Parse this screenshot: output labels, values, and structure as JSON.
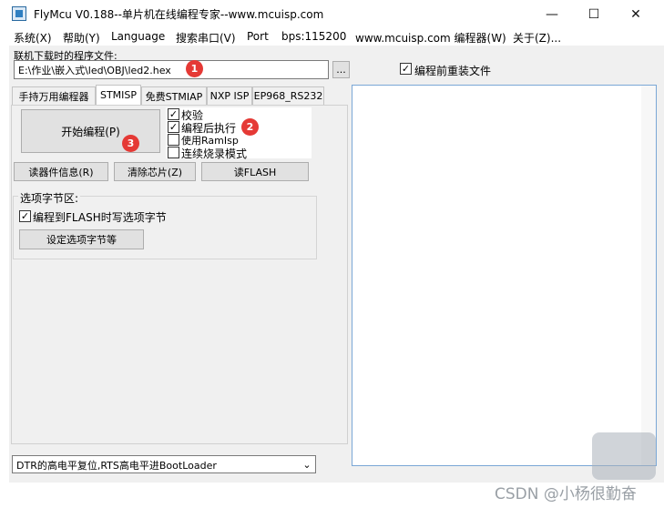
{
  "window": {
    "title": "FlyMcu V0.188--单片机在线编程专家--www.mcuisp.com",
    "minimize_symbol": "—",
    "maximize_symbol": "☐",
    "close_symbol": "✕"
  },
  "menu": [
    "系统(X)",
    "帮助(Y)",
    "Language",
    "搜索串口(V)",
    "Port",
    "bps:115200",
    "www.mcuisp.com 编程器(W)",
    "关于(Z)..."
  ],
  "file": {
    "label": "联机下载时的程序文件:",
    "path": "E:\\作业\\嵌入式\\led\\OBJ\\led2.hex",
    "browse_label": "..."
  },
  "reload_before_program": {
    "label": "编程前重装文件",
    "checked": true
  },
  "tabs": [
    "手持万用编程器",
    "STMISP",
    "免费STMIAP",
    "NXP ISP",
    "EP968_RS232"
  ],
  "active_tab": "STMISP",
  "stmisp": {
    "start_button": "开始编程(P)",
    "options": [
      {
        "label": "校验",
        "checked": true
      },
      {
        "label": "编程后执行",
        "checked": true
      },
      {
        "label": "使用RamIsp",
        "checked": false
      },
      {
        "label": "连续烧录模式",
        "checked": false
      }
    ],
    "read_info_button": "读器件信息(R)",
    "erase_button": "清除芯片(Z)",
    "read_flash_button": "读FLASH",
    "option_bytes": {
      "group_label": "选项字节区:",
      "write_label": "编程到FLASH时写选项字节",
      "write_checked": true,
      "set_button": "设定选项字节等"
    }
  },
  "bootloader_select": "DTR的高电平复位,RTS高电平进BootLoader",
  "badges": [
    "1",
    "2",
    "3"
  ],
  "watermark": "CSDN @小杨很勤奋",
  "colors": {
    "badge": "#e53935",
    "output_border": "#7aa7d6"
  },
  "icons": [
    "app-icon",
    "chevron-down-icon",
    "check-icon",
    "chat-bubble-icon"
  ]
}
